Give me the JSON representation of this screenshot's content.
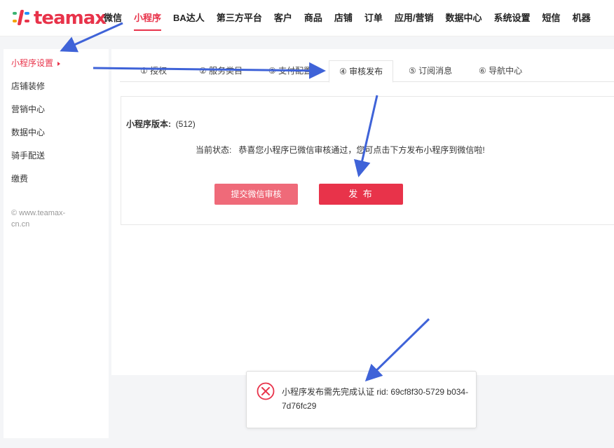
{
  "brand": {
    "logo_text": "teamax",
    "logo_colors": [
      "#3cb371",
      "#f4a300",
      "#1e90ff",
      "#e8334a"
    ],
    "accent": "#e8334a"
  },
  "nav": {
    "items": [
      "微信",
      "小程序",
      "BA达人",
      "第三方平台",
      "客户",
      "商品",
      "店铺",
      "订单",
      "应用/营销",
      "数据中心",
      "系统设置",
      "短信",
      "机器"
    ],
    "active_index": 1
  },
  "sidebar": {
    "items": [
      "小程序设置",
      "店铺装修",
      "营销中心",
      "数据中心",
      "骑手配送",
      "缴费"
    ],
    "active_index": 0,
    "footer": "© www.teamax-cn.cn"
  },
  "tabs": {
    "items": [
      "① 授权",
      "② 服务类目",
      "③ 支付配置",
      "④ 审核发布",
      "⑤ 订阅消息",
      "⑥ 导航中心"
    ],
    "active_index": 3
  },
  "release": {
    "version_label": "小程序版本:",
    "version_value": "(512)",
    "status_label": "当前状态:",
    "status_text": "恭喜您小程序已微信审核通过，您可点击下方发布小程序到微信啦!",
    "submit_button": "提交微信审核",
    "publish_button": "发 布"
  },
  "toast": {
    "icon": "error-circle-icon",
    "message": "小程序发布需先完成认证 rid: 69cf8f30-5729 b034-7d76fc29",
    "color": "#e8334a"
  },
  "annotation": {
    "arrow_color": "#3f63d8"
  }
}
